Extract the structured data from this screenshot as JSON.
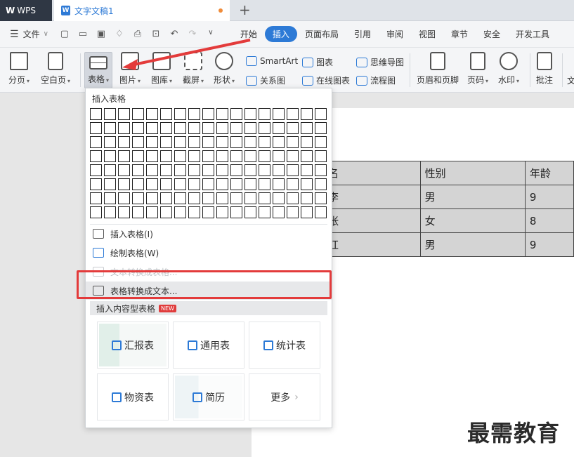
{
  "titlebar": {
    "app_label": "WPS",
    "doc_title": "文字文稿1",
    "new_tab": "+"
  },
  "menubar": {
    "file_label": "文件",
    "tabs": [
      {
        "label": "开始",
        "active": false
      },
      {
        "label": "插入",
        "active": true
      },
      {
        "label": "页面布局",
        "active": false
      },
      {
        "label": "引用",
        "active": false
      },
      {
        "label": "审阅",
        "active": false
      },
      {
        "label": "视图",
        "active": false
      },
      {
        "label": "章节",
        "active": false
      },
      {
        "label": "安全",
        "active": false
      },
      {
        "label": "开发工具",
        "active": false
      }
    ]
  },
  "ribbon": {
    "pagebreak": "分页",
    "blankpage": "空白页",
    "table": "表格",
    "picture": "图片",
    "gallery": "图库",
    "screenshot": "截屏",
    "shape": "形状",
    "smartart": "SmartArt",
    "relation": "关系图",
    "chart": "图表",
    "online_chart": "在线图表",
    "mindmap": "思维导图",
    "flowchart": "流程图",
    "header_footer": "页眉和页脚",
    "page_number": "页码",
    "watermark": "水印",
    "comment": "批注",
    "cut_text": "文"
  },
  "dropdown": {
    "title": "插入表格",
    "items": [
      {
        "label": "插入表格(I)",
        "disabled": false
      },
      {
        "label": "绘制表格(W)",
        "disabled": false
      },
      {
        "label": "文本转换成表格...",
        "disabled": true
      },
      {
        "label": "表格转换成文本...",
        "disabled": false
      }
    ],
    "section_title": "插入内容型表格",
    "new_badge": "NEW",
    "cards": [
      {
        "label": "汇报表",
        "icon": "report-icon"
      },
      {
        "label": "通用表",
        "icon": "grid-icon"
      },
      {
        "label": "统计表",
        "icon": "chart-icon"
      },
      {
        "label": "物资表",
        "icon": "box-icon"
      },
      {
        "label": "简历",
        "icon": "resume-icon"
      },
      {
        "label": "更多",
        "icon": "chevron-right-icon"
      }
    ]
  },
  "document_table": {
    "rows": [
      [
        "名",
        "性别",
        "年龄"
      ],
      [
        "李",
        "男",
        "9"
      ],
      [
        "张",
        "女",
        "8"
      ],
      [
        "红",
        "男",
        "9"
      ]
    ]
  },
  "watermark_text": "最需教育",
  "colors": {
    "accent": "#2d7ad6",
    "annotation_red": "#e33b3b"
  }
}
